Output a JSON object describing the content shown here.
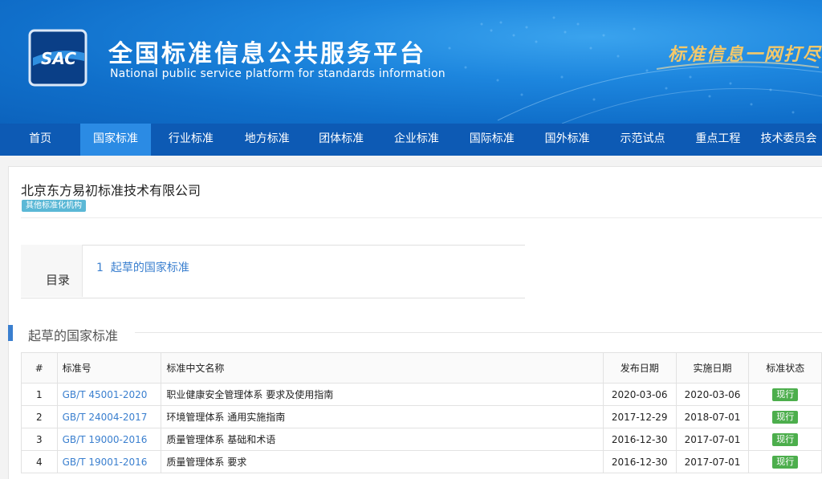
{
  "header": {
    "logo_text": "SAC",
    "title": "全国标准信息公共服务平台",
    "subtitle": "National public service platform  for standards information",
    "slogan": "标准信息一网打尽"
  },
  "nav": {
    "items": [
      {
        "label": "首页"
      },
      {
        "label": "国家标准"
      },
      {
        "label": "行业标准"
      },
      {
        "label": "地方标准"
      },
      {
        "label": "团体标准"
      },
      {
        "label": "企业标准"
      },
      {
        "label": "国际标准"
      },
      {
        "label": "国外标准"
      },
      {
        "label": "示范试点"
      },
      {
        "label": "重点工程"
      },
      {
        "label": "技术委员会"
      }
    ],
    "active": "国家标准"
  },
  "org": {
    "name": "北京东方易初标准技术有限公司",
    "badge": "其他标准化机构"
  },
  "toc": {
    "label": "目录",
    "items": [
      {
        "number": "1",
        "label": "起草的国家标准"
      }
    ]
  },
  "section": {
    "title": "起草的国家标准"
  },
  "table": {
    "headers": [
      "#",
      "标准号",
      "标准中文名称",
      "发布日期",
      "实施日期",
      "标准状态"
    ],
    "rows": [
      {
        "index": "1",
        "code": "GB/T 45001-2020",
        "name": "职业健康安全管理体系 要求及使用指南",
        "publish": "2020-03-06",
        "implement": "2020-03-06",
        "status": "现行"
      },
      {
        "index": "2",
        "code": "GB/T 24004-2017",
        "name": "环境管理体系 通用实施指南",
        "publish": "2017-12-29",
        "implement": "2018-07-01",
        "status": "现行"
      },
      {
        "index": "3",
        "code": "GB/T 19000-2016",
        "name": "质量管理体系 基础和术语",
        "publish": "2016-12-30",
        "implement": "2017-07-01",
        "status": "现行"
      },
      {
        "index": "4",
        "code": "GB/T 19001-2016",
        "name": "质量管理体系 要求",
        "publish": "2016-12-30",
        "implement": "2017-07-01",
        "status": "现行"
      }
    ]
  },
  "colors": {
    "banner": "#106fca",
    "nav": "#0d5ab4",
    "nav_active": "#2b8be4",
    "link": "#3a7fcf",
    "badge": "#5bb8d6",
    "status": "#4cae4c"
  }
}
